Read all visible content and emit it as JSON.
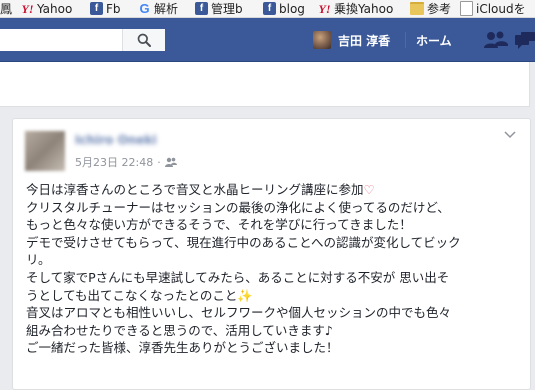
{
  "bookmarks": [
    {
      "label": "鳳",
      "icon": "none"
    },
    {
      "label": "Yahoo",
      "icon": "yahoo-icon"
    },
    {
      "label": "Fb",
      "icon": "facebook-icon"
    },
    {
      "label": "解析",
      "icon": "google-icon"
    },
    {
      "label": "管理b",
      "icon": "facebook-icon"
    },
    {
      "label": "blog",
      "icon": "facebook-icon"
    },
    {
      "label": "乗換Yahoo",
      "icon": "yahoo-icon"
    },
    {
      "label": "参考",
      "icon": "folder-icon"
    },
    {
      "label": "iCloudを",
      "icon": "document-icon"
    }
  ],
  "header": {
    "user_name": "吉田 淳香",
    "home_label": "ホーム",
    "brand_color": "#3b5998"
  },
  "post": {
    "author": "Ichiro Oneki",
    "date": "5月23日 22:48",
    "separator": "·",
    "audience_icon": "friends-icon",
    "lines": [
      "今日は淳香さんのところで音叉と水晶ヒーリング講座に参加",
      "クリスタルチューナーはセッションの最後の浄化によく使ってるのだけど、",
      "もっと色々な使い方ができるそうで、それを学びに行ってきました！",
      "デモで受けさせてもらって、現在進行中のあることへの認識が変化してビック",
      "リ。",
      "そして家でPさんにも早速試してみたら、あることに対する不安が 思い出そ",
      "うとしても出てこなくなったとのこと",
      "音叉はアロマとも相性いいし、セルフワークや個人セッションの中でも色々",
      "組み合わせたりできると思うので、活用していきます♪",
      "ご一緒だった皆様、淳香先生ありがとうございました！"
    ],
    "heart_glyph": "♡",
    "sparkle_glyph": "✨"
  }
}
